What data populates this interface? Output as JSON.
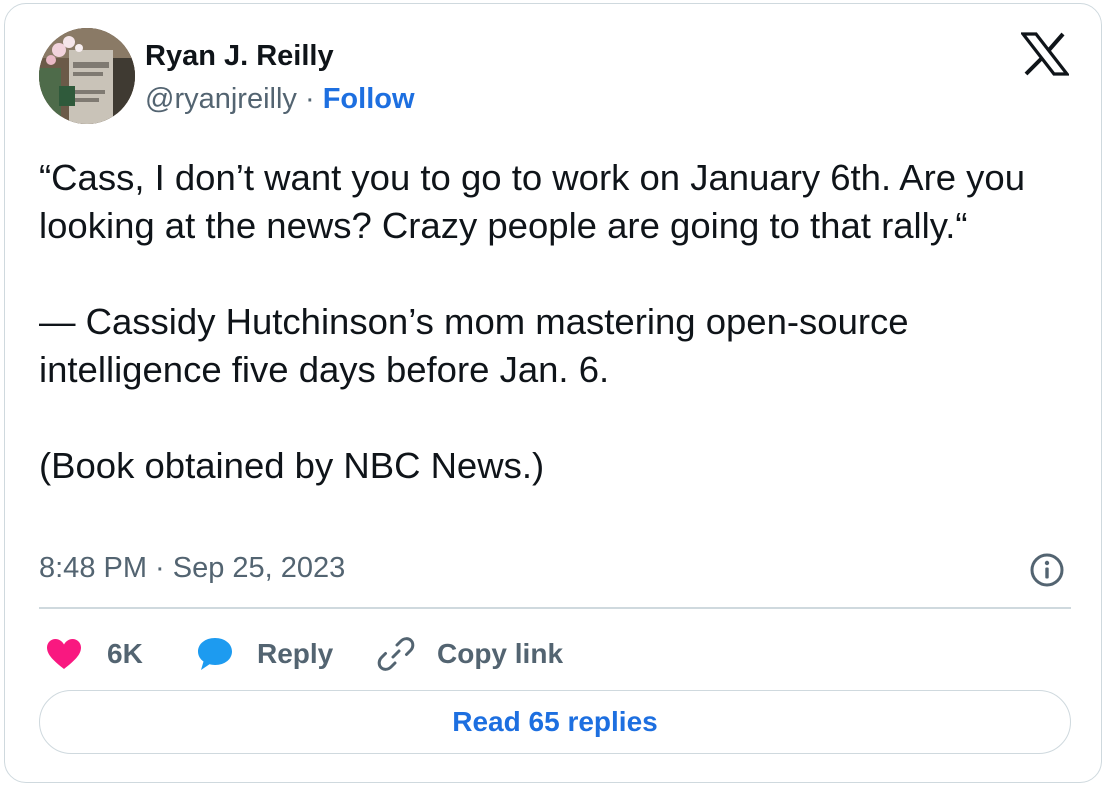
{
  "author": {
    "name": "Ryan J. Reilly",
    "handle": "@ryanjreilly",
    "separator": " · ",
    "follow_label": "Follow"
  },
  "tweet": {
    "paragraphs": [
      "“Cass, I don’t want you to go to work on January 6th. Are you looking at the news? Crazy people are going to that rally.“",
      "— Cassidy Hutchinson’s mom mastering open-source intelligence five days before Jan. 6.",
      "(Book obtained by NBC News.)"
    ],
    "timestamp": "8:48 PM · Sep 25, 2023"
  },
  "actions": {
    "like_count": "6K",
    "reply_label": "Reply",
    "copy_label": "Copy link"
  },
  "read_replies_label": "Read 65 replies",
  "icons": {
    "avatar": "avatar-photo",
    "logo": "x-logo-icon",
    "info": "info-icon",
    "like": "heart-icon",
    "reply": "speech-bubble-icon",
    "copy": "link-icon"
  },
  "colors": {
    "text_primary": "#0f1419",
    "text_secondary": "#536471",
    "link_blue": "#1d6fe0",
    "heart_pink": "#f91880",
    "reply_blue": "#1d9bf0",
    "border": "#cfd9de"
  }
}
